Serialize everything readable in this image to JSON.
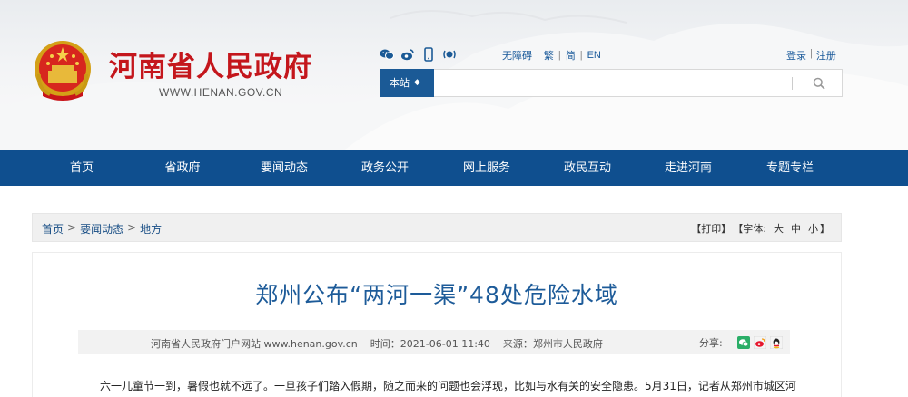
{
  "header": {
    "site_title": "河南省人民政府",
    "site_url": "WWW.HENAN.GOV.CN",
    "social_icons": [
      "wechat-icon",
      "weibo-icon",
      "mobile-icon",
      "audio-icon"
    ],
    "lang_links": [
      "无障碍",
      "繁",
      "简",
      "EN"
    ],
    "login": "登录",
    "register": "注册",
    "search": {
      "scope": "本站",
      "placeholder": ""
    }
  },
  "nav": {
    "items": [
      "首页",
      "省政府",
      "要闻动态",
      "政务公开",
      "网上服务",
      "政民互动",
      "走进河南",
      "专题专栏"
    ]
  },
  "breadcrumb": {
    "items": [
      "首页",
      "要闻动态",
      "地方"
    ],
    "separator": ">"
  },
  "tools": {
    "print": "【打印】",
    "font_label": "【字体:",
    "font_large": "大",
    "font_medium": "中",
    "font_small": "小",
    "font_close": "】"
  },
  "article": {
    "title": "郑州公布“两河一渠”48处危险水域",
    "source_site": "河南省人民政府门户网站 www.henan.gov.cn",
    "time": "时间：2021-06-01 11:40",
    "origin": "来源：郑州市人民政府",
    "share_label": "分享:",
    "share_icons": [
      "wechat-share-icon",
      "weibo-share-icon",
      "qq-share-icon"
    ],
    "body": "六一儿童节一到，暑假也就不远了。一旦孩子们踏入假期，随之而来的问题也会浮现，比如与水有关的安全隐患。5月31日，记者从郑州市城区河"
  },
  "colors": {
    "brand_red": "#c4161c",
    "nav_blue": "#0f4f8f",
    "title_blue": "#1d5b99",
    "link_blue": "#1a5a9a"
  }
}
